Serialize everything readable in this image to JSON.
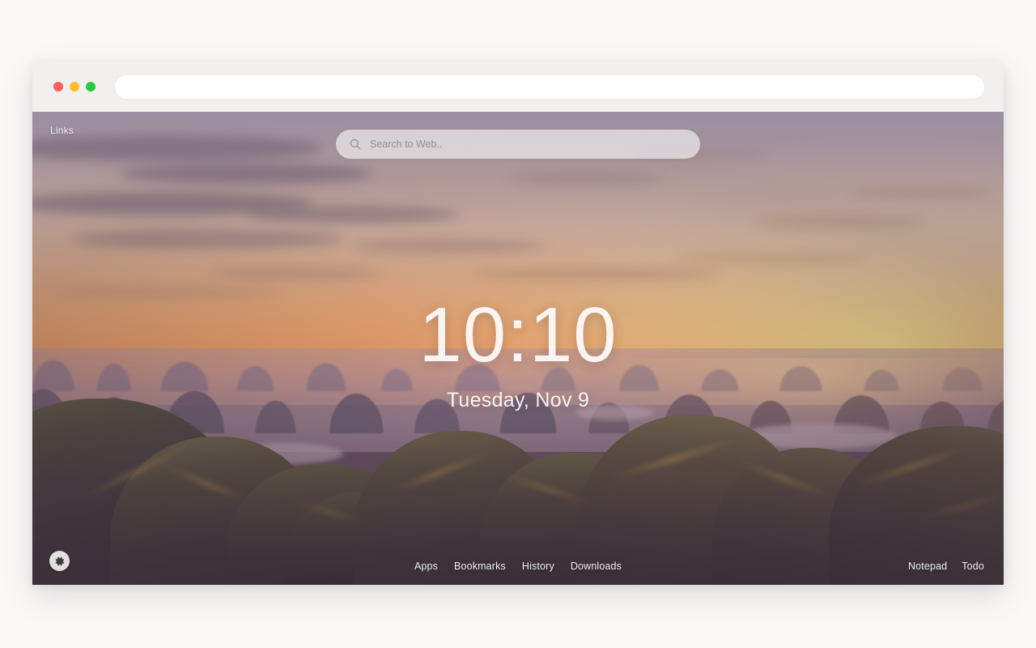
{
  "window": {
    "traffic_lights": [
      {
        "name": "close",
        "color": "#fe5f57"
      },
      {
        "name": "minimize",
        "color": "#febc2e"
      },
      {
        "name": "maximize",
        "color": "#28c840"
      }
    ],
    "url_bar": {
      "value": "",
      "placeholder": ""
    }
  },
  "newtab": {
    "links_label": "Links",
    "search": {
      "icon": "search-icon",
      "value": "",
      "placeholder": "Search to Web.."
    },
    "clock": {
      "time": "10:10",
      "date": "Tuesday, Nov 9"
    },
    "settings": {
      "icon": "gear-icon",
      "label": "Settings"
    },
    "nav_center": [
      {
        "label": "Apps"
      },
      {
        "label": "Bookmarks"
      },
      {
        "label": "History"
      },
      {
        "label": "Downloads"
      }
    ],
    "nav_right": [
      {
        "label": "Notepad"
      },
      {
        "label": "Todo"
      }
    ]
  },
  "theme": {
    "page_background": "#faf9f8",
    "toolbar_background": "#f1f0ef",
    "url_bar_background": "#ffffff",
    "search_text": "#55484a",
    "overlay_text": "#ffffff",
    "wallpaper_description": "Sunset over Ha Long Bay karst mountains"
  }
}
